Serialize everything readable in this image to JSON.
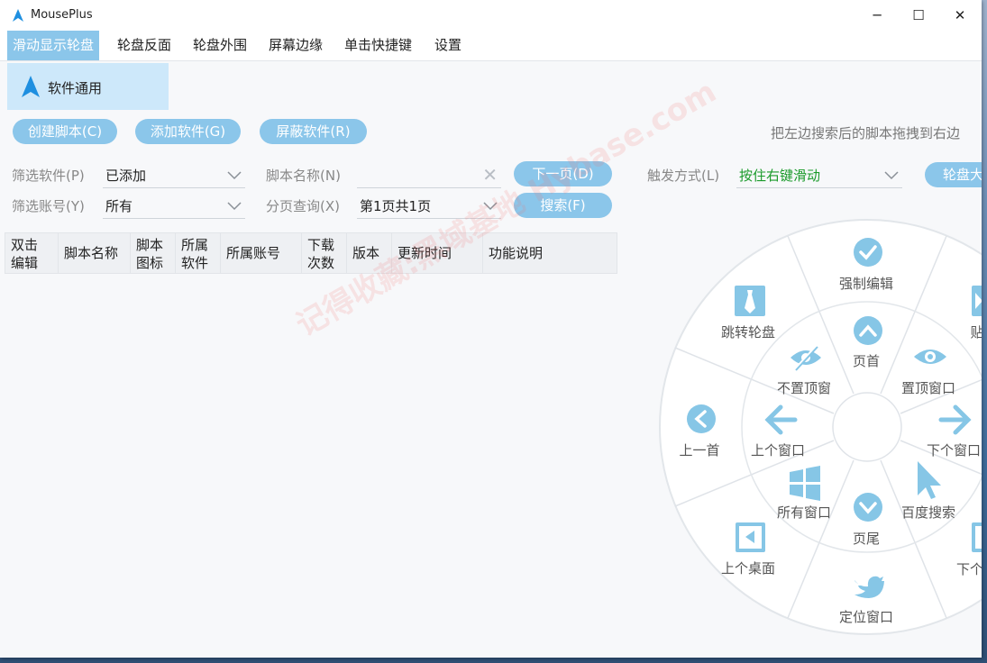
{
  "app": {
    "title": "MousePlus",
    "controls": {
      "minimize": "─",
      "maximize": "☐",
      "close": "✕"
    }
  },
  "menu": {
    "tabs": [
      "滑动显示轮盘",
      "轮盘反面",
      "轮盘外围",
      "屏幕边缘",
      "单击快捷键",
      "设置"
    ]
  },
  "software_list": {
    "items": [
      "软件通用"
    ]
  },
  "toolbar": {
    "create_script": "创建脚本(C)",
    "add_software": "添加软件(G)",
    "block_software": "屏蔽软件(R)",
    "hint": "把左边搜索后的脚本拖拽到右边"
  },
  "filters": {
    "software_label": "筛选软件(P)",
    "software_value": "已添加",
    "account_label": "筛选账号(Y)",
    "account_value": "所有",
    "script_name_label": "脚本名称(N)",
    "script_name_value": "",
    "page_query_label": "分页查询(X)",
    "page_value": "第1页共1页",
    "next_page": "下一页(D)",
    "search": "搜索(F)",
    "trigger_label": "触发方式(L)",
    "trigger_value": "按住右键滑动",
    "wheel_btn": "轮盘大"
  },
  "table": {
    "headers": [
      "双击\n编辑",
      "脚本名称",
      "脚本\n图标",
      "所属\n软件",
      "所属账号",
      "下载\n次数",
      "版本",
      "更新时间",
      "功能说明"
    ]
  },
  "watermark": "记得收藏:黑域基地 Hybase.com",
  "wheel": {
    "outer": [
      "强制编辑",
      "贴",
      "下个窗口",
      "下个",
      "定位窗口",
      "上个桌面",
      "上一首",
      "跳转轮盘"
    ],
    "inner": [
      "页首",
      "置顶窗口",
      "百度搜索",
      "页尾",
      "所有窗口",
      "上个窗口",
      "不置顶窗",
      "下个窗口"
    ]
  },
  "colors": {
    "accent": "#8bc6ea",
    "icon": "#86c6e6",
    "trigger_text": "#1a9a2a"
  }
}
